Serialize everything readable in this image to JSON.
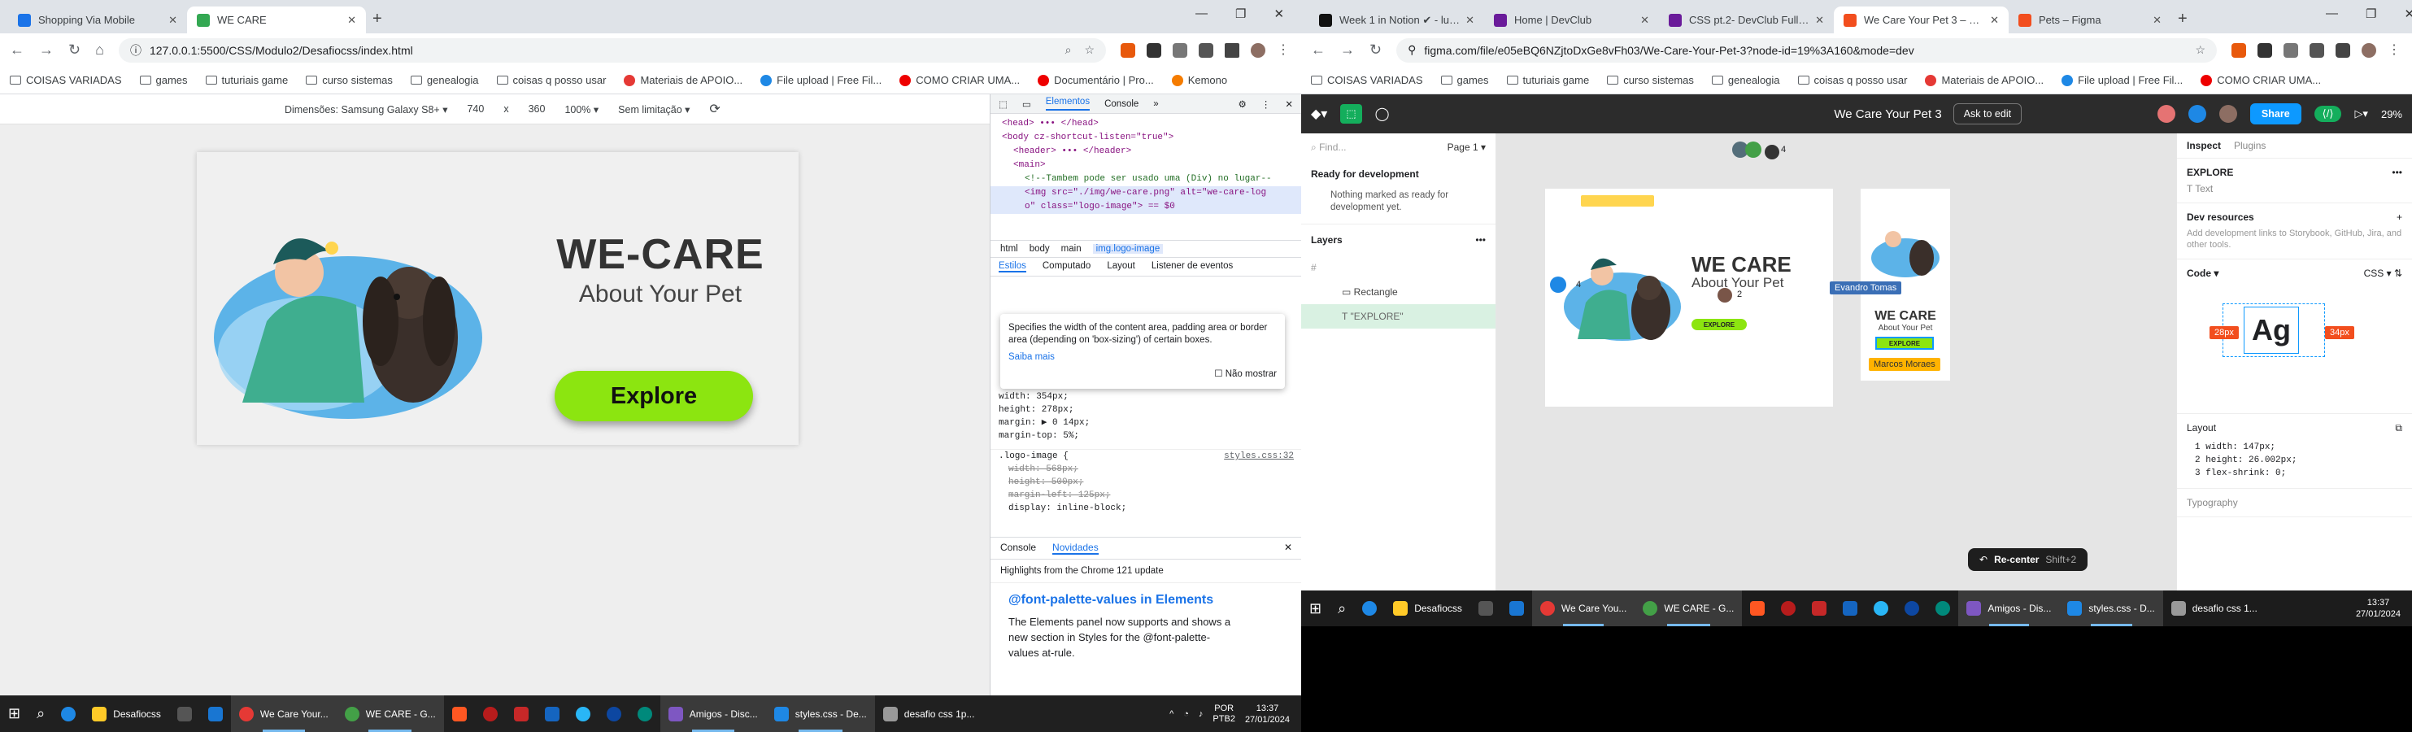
{
  "left": {
    "tabs": [
      {
        "label": "Shopping Via Mobile",
        "color": "#1a73e8",
        "active": false
      },
      {
        "label": "WE CARE",
        "color": "#34a853",
        "active": true
      }
    ],
    "address": "127.0.0.1:5500/CSS/Modulo2/Desafiocss/index.html",
    "bookmarks": [
      "COISAS VARIADAS",
      "games",
      "tuturiais game",
      "curso sistemas",
      "genealogia",
      "coisas q posso usar",
      "Materiais de APOIO...",
      "File upload | Free Fil...",
      "COMO CRIAR UMA...",
      "Documentário | Pro...",
      "Kemono"
    ],
    "device": {
      "label": "Dimensões: Samsung Galaxy S8+",
      "width": "740",
      "x": "x",
      "height": "360",
      "zoom": "100%",
      "throttle": "Sem limitação"
    },
    "page": {
      "title": "WE-CARE",
      "subtitle": "About Your Pet",
      "button": "Explore"
    },
    "devtools": {
      "tabs": [
        "Elementos",
        "Console"
      ],
      "code": [
        {
          "t": "<head> ••• </head>"
        },
        {
          "t": "<body cz-shortcut-listen=\"true\">"
        },
        {
          "t": "<header> ••• </header>"
        },
        {
          "t": "<main>"
        },
        {
          "t": "<!--Tambem pode ser usado uma (Div) no lugar--"
        },
        {
          "t": "<img src=\"./img/we-care.png\" alt=\"we-care-log"
        },
        {
          "t": "o\" class=\"logo-image\"> == $0"
        }
      ],
      "crumbs": [
        "html",
        "body",
        "main",
        "img.logo-image"
      ],
      "subtabs": [
        "Estilos",
        "Computado",
        "Layout",
        "Listener de eventos"
      ],
      "tooltip": {
        "text": "Specifies the width of the content area, padding area or border area (depending on 'box-sizing') of certain boxes.",
        "link": "Saiba mais",
        "checkbox": "Não mostrar"
      },
      "css1": [
        "width: 354px;",
        "height: 278px;",
        "margin: ▶ 0 14px;",
        "margin-top: 5%;"
      ],
      "css2_selector": ".logo-image {",
      "css2_file": "styles.css:32",
      "css2": [
        "width: 568px;",
        "height: 500px;",
        "margin-left: 125px;",
        "display: inline-block;"
      ],
      "drawer_tabs": [
        "Console",
        "Novidades"
      ],
      "drawer_line": "Highlights from the Chrome 121 update",
      "drawer_title": "@font-palette-values in Elements",
      "drawer_text": "The Elements panel now supports and shows a new section in Styles for the @font-palette-values at-rule."
    },
    "taskbar": {
      "apps": [
        "Desafiocss",
        "We Care Your...",
        "WE CARE - G...",
        "Amigos - Disc...",
        "styles.css - De...",
        "desafio css 1p..."
      ],
      "lang": "POR\nPTB2",
      "time": "13:37",
      "date": "27/01/2024"
    }
  },
  "right": {
    "tabs": [
      {
        "label": "Week 1 in Notion ✔ - lucin",
        "color": "#111"
      },
      {
        "label": "Home | DevClub",
        "color": "#6a1b9a"
      },
      {
        "label": "CSS pt.2- DevClub Full Stack",
        "color": "#6a1b9a"
      },
      {
        "label": "We Care Your Pet 3 – Figma",
        "color": "#f24e1e"
      },
      {
        "label": "Pets – Figma",
        "color": "#f24e1e"
      }
    ],
    "address": "figma.com/file/e05eBQ6NZjtoDxGe8vFh03/We-Care-Your-Pet-3?node-id=19%3A160&mode=dev",
    "bookmarks": [
      "COISAS VARIADAS",
      "games",
      "tuturiais game",
      "curso sistemas",
      "genealogia",
      "coisas q posso usar",
      "Materiais de APOIO...",
      "File upload | Free Fil...",
      "COMO CRIAR UMA..."
    ],
    "figma": {
      "file_title": "We Care Your Pet 3",
      "ask": "Ask to edit",
      "share": "Share",
      "zoom": "29%",
      "page": "Page 1",
      "find": "Find...",
      "ready": "Ready for development",
      "ready_note": "Nothing marked as ready for development yet.",
      "layers_title": "Layers",
      "layers": [
        "Rectangle",
        "\"EXPLORE\""
      ],
      "inspect_tabs": [
        "Inspect",
        "Plugins"
      ],
      "layer_name": "EXPLORE",
      "layer_type": "Text",
      "dev_resources": "Dev resources",
      "dev_note": "Add development links to Storybook, GitHub, Jira, and other tools.",
      "code": "Code",
      "lang": "CSS",
      "specimen": "Ag",
      "left_px": "28px",
      "right_px": "34px",
      "layout": "Layout",
      "layout_code": [
        "width: 147px;",
        "height: 26.002px;",
        "flex-shrink: 0;"
      ],
      "typography": "Typography",
      "canvas": {
        "frame_title": "WE CARE",
        "frame_sub": "About Your Pet",
        "frame_btn": "EXPLORE",
        "small_title": "WE CARE",
        "small_sub": "About Your Pet",
        "small_btn": "EXPLORE",
        "user1": "Evandro Tomas",
        "user2": "Marcos Moraes",
        "count1": "4",
        "count2": "4",
        "count3": "2",
        "recenter": "Re-center",
        "recenter_key": "Shift+2"
      }
    },
    "taskbar": {
      "apps": [
        "Desafiocss",
        "We Care You...",
        "WE CARE - G...",
        "Amigos - Dis...",
        "styles.css - D...",
        "desafio css 1..."
      ],
      "time": "13:37",
      "date": "27/01/2024"
    }
  }
}
